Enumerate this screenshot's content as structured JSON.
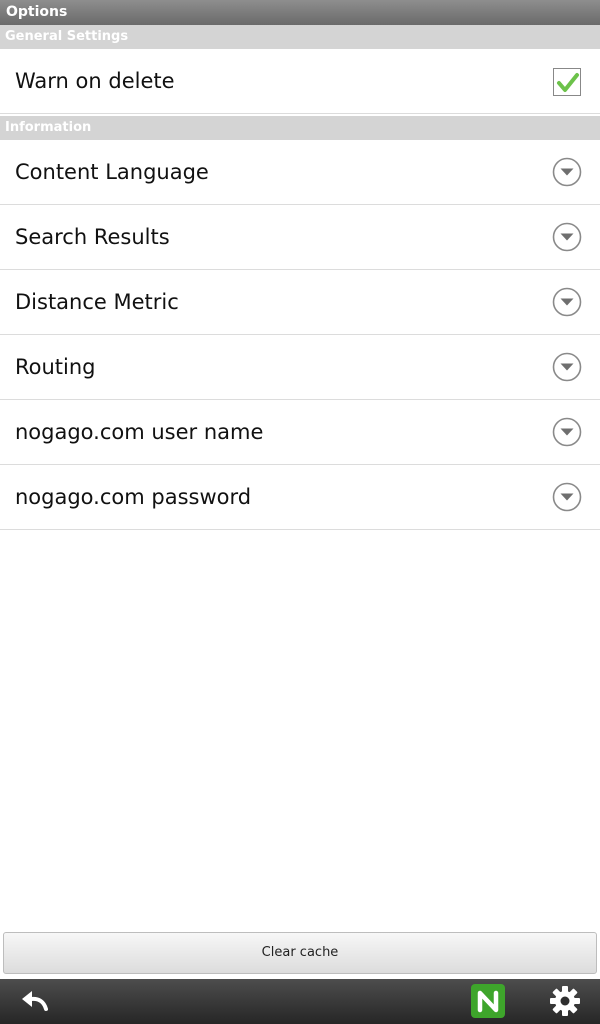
{
  "window": {
    "title": "Options"
  },
  "sections": [
    {
      "header": "General Settings"
    },
    {
      "header": "Information"
    }
  ],
  "general": {
    "warn_on_delete": {
      "label": "Warn on delete",
      "checked": true
    }
  },
  "information": {
    "items": [
      {
        "label": "Content Language",
        "icon": "chevron-down-circle-icon"
      },
      {
        "label": "Search Results",
        "icon": "chevron-down-circle-icon"
      },
      {
        "label": "Distance Metric",
        "icon": "chevron-down-circle-icon"
      },
      {
        "label": "Routing",
        "icon": "chevron-down-circle-icon"
      },
      {
        "label": "nogago.com user name",
        "icon": "chevron-down-circle-icon"
      },
      {
        "label": "nogago.com password",
        "icon": "chevron-down-circle-icon"
      }
    ]
  },
  "actions": {
    "clear_cache": "Clear cache"
  },
  "bottom_bar": {
    "icons": [
      "back-arrow-icon",
      "nogago-app-icon",
      "gear-icon"
    ]
  },
  "colors": {
    "title_bar": "#6a6a6a",
    "section_header": "#d4d4d4",
    "checkmark": "#6cc24a",
    "app_icon": "#3ea52b",
    "bottom_bar": "#262626"
  }
}
